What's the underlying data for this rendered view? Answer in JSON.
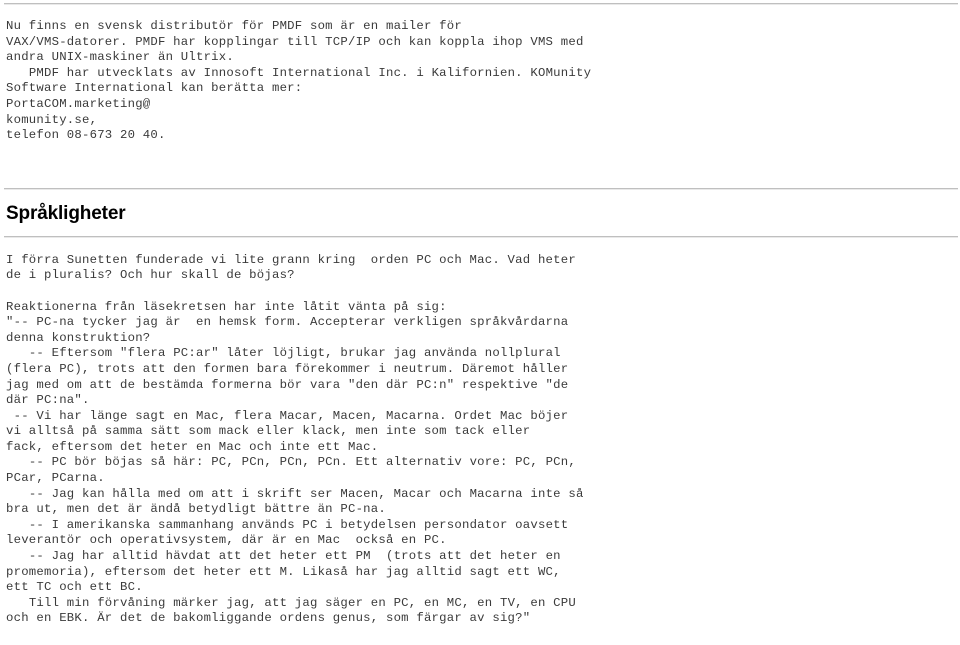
{
  "document": {
    "language": "sv",
    "text_color": "#3a3a3a",
    "heading_color": "#000000",
    "rule_color": "#bfbfbf",
    "background_color": "#ffffff"
  },
  "intro": {
    "text": "Nu finns en svensk distributör för PMDF som är en mailer för\nVAX/VMS-datorer. PMDF har kopplingar till TCP/IP och kan koppla ihop VMS med\nandra UNIX-maskiner än Ultrix.\n   PMDF har utvecklats av Innosoft International Inc. i Kalifornien. KOMunity\nSoftware International kan berätta mer:\nPortaCOM.marketing@\nkomunity.se,\ntelefon 08-673 20 40."
  },
  "section": {
    "heading": "Språkligheter"
  },
  "body": {
    "text": "I förra Sunetten funderade vi lite grann kring  orden PC och Mac. Vad heter\nde i pluralis? Och hur skall de böjas?\n\nReaktionerna från läsekretsen har inte låtit vänta på sig:\n\"-- PC-na tycker jag är  en hemsk form. Accepterar verkligen språkvårdarna\ndenna konstruktion?\n   -- Eftersom \"flera PC:ar\" låter löjligt, brukar jag använda nollplural\n(flera PC), trots att den formen bara förekommer i neutrum. Däremot håller\njag med om att de bestämda formerna bör vara \"den där PC:n\" respektive \"de\ndär PC:na\".\n -- Vi har länge sagt en Mac, flera Macar, Macen, Macarna. Ordet Mac böjer\nvi alltså på samma sätt som mack eller klack, men inte som tack eller\nfack, eftersom det heter en Mac och inte ett Mac.\n   -- PC bör böjas så här: PC, PCn, PCn, PCn. Ett alternativ vore: PC, PCn,\nPCar, PCarna.\n   -- Jag kan hålla med om att i skrift ser Macen, Macar och Macarna inte så\nbra ut, men det är ändå betydligt bättre än PC-na.\n   -- I amerikanska sammanhang används PC i betydelsen persondator oavsett\nleverantör och operativsystem, där är en Mac  också en PC.\n   -- Jag har alltid hävdat att det heter ett PM  (trots att det heter en\npromemoria), eftersom det heter ett M. Likaså har jag alltid sagt ett WC,\nett TC och ett BC.\n   Till min förvåning märker jag, att jag säger en PC, en MC, en TV, en CPU\noch en EBK. Är det de bakomliggande ordens genus, som färgar av sig?\""
  }
}
